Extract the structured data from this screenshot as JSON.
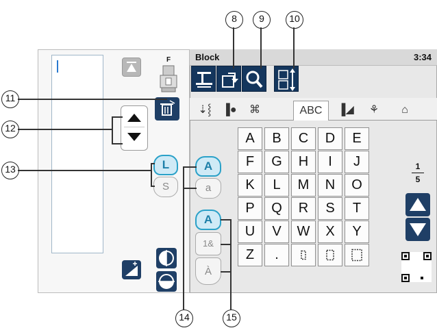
{
  "screen": {
    "title": "Block",
    "time": "3:34"
  },
  "presser_foot": {
    "label": "F"
  },
  "toolbar": {
    "buttons": [
      "needle-up-down-icon",
      "undo-memory-icon",
      "magnify-icon",
      "letter-size-icon"
    ]
  },
  "tabs": [
    {
      "label": "⇣⸾",
      "icon": "stitch-utility-tab"
    },
    {
      "label": "▐●",
      "icon": "buttonhole-tab"
    },
    {
      "label": "⌘",
      "icon": "decorative-tab"
    },
    {
      "label": "ABC",
      "icon": "alphabet-tab",
      "active": true
    },
    {
      "label": "▐◢",
      "icon": "satin-tab"
    },
    {
      "label": "⚘",
      "icon": "applique-tab"
    },
    {
      "label": "⌂",
      "icon": "memory-tab"
    }
  ],
  "keys": [
    "A",
    "B",
    "C",
    "D",
    "E",
    "F",
    "G",
    "H",
    "I",
    "J",
    "K",
    "L",
    "M",
    "N",
    "O",
    "P",
    "Q",
    "R",
    "S",
    "T",
    "U",
    "V",
    "W",
    "X",
    "Y",
    "Z",
    "."
  ],
  "space_keys": [
    "small-space-icon",
    "medium-space-icon",
    "large-space-icon"
  ],
  "page_indicator": {
    "current": "1",
    "total": "5"
  },
  "size_buttons": {
    "large": "L",
    "small": "S"
  },
  "case_buttons": {
    "upper": "A",
    "lower": "a"
  },
  "char_set_buttons": {
    "latin": "A",
    "numeric": "1&",
    "accented": "À"
  },
  "callouts": {
    "c8": "8",
    "c9": "9",
    "c10": "10",
    "c11": "11",
    "c12": "12",
    "c13": "13",
    "c14": "14",
    "c15": "15"
  },
  "colors": {
    "dark_blue": "#1f3f66",
    "teal": "#2aa1c8",
    "panel": "#e8e8e8"
  }
}
